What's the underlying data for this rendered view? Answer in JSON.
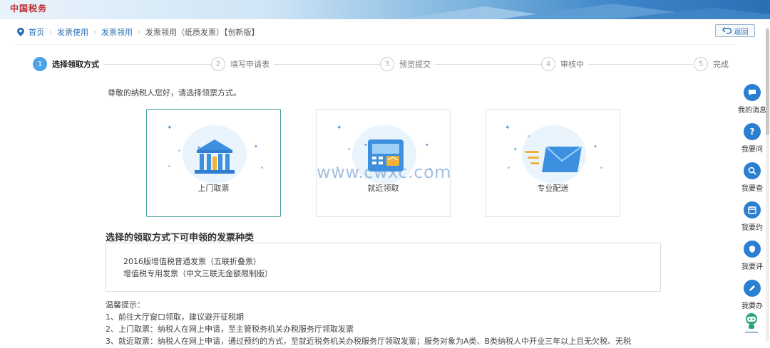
{
  "banner": {
    "logo_text": "中国税务"
  },
  "breadcrumb": {
    "items": [
      "首页",
      "发票使用",
      "发票领用"
    ],
    "current": "发票领用（纸质发票）【创新版】"
  },
  "back_button": {
    "label": "返回"
  },
  "steps": [
    {
      "num": "1",
      "label": "选择领取方式",
      "active": true
    },
    {
      "num": "2",
      "label": "填写申请表",
      "active": false
    },
    {
      "num": "3",
      "label": "预览提交",
      "active": false
    },
    {
      "num": "4",
      "label": "审核中",
      "active": false
    },
    {
      "num": "5",
      "label": "完成",
      "active": false
    }
  ],
  "greeting": "尊敬的纳税人您好，请选择领票方式。",
  "options": [
    {
      "label": "上门取票",
      "icon": "bank-building-icon",
      "selected": true
    },
    {
      "label": "就近领取",
      "icon": "self-service-terminal-icon",
      "selected": false
    },
    {
      "label": "专业配送",
      "icon": "envelope-delivery-icon",
      "selected": false
    }
  ],
  "watermark": "www.cwxc.com",
  "invoice_section": {
    "title": "选择的领取方式下可申领的发票种类",
    "types": [
      "2016版增值税普通发票（五联折叠票）",
      "增值税专用发票（中文三联无金额限制版）"
    ]
  },
  "tips": {
    "heading": "温馨提示：",
    "lines": [
      "1、前往大厅窗口领取，建议避开征税期",
      "2、上门取票：纳税人在网上申请，至主管税务机关办税服务厅领取发票",
      "3、就近取票：纳税人在网上申请，通过预约的方式，至就近税务机关办税服务厅领取发票；服务对象为A类、B类纳税人中开业三年以上且无欠税、无税"
    ]
  },
  "sidebar": [
    {
      "label": "我的消息",
      "icon": "message-icon"
    },
    {
      "label": "我要问",
      "icon": "question-icon"
    },
    {
      "label": "我要查",
      "icon": "search-icon"
    },
    {
      "label": "我要约",
      "icon": "calendar-icon"
    },
    {
      "label": "我要评",
      "icon": "rating-icon"
    },
    {
      "label": "我要办",
      "icon": "edit-icon"
    }
  ],
  "colors": {
    "accent": "#4da3e6",
    "link": "#2a6fb5",
    "selected_border": "#4aa19c",
    "sidebar_icon": "#2b7fd0"
  }
}
